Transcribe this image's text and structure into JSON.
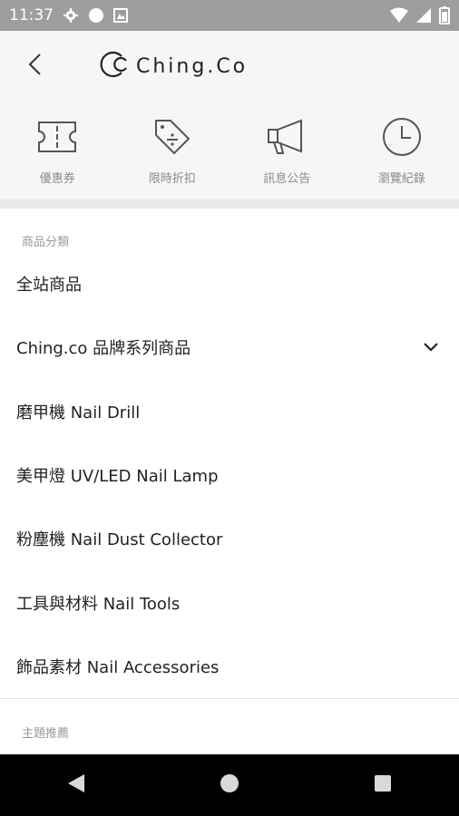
{
  "status_bar": {
    "time": "11:37"
  },
  "app_bar": {
    "brand": "Ching.Co"
  },
  "quick_actions": [
    {
      "label": "優惠券",
      "icon": "ticket-icon"
    },
    {
      "label": "限時折扣",
      "icon": "discount-tag-icon"
    },
    {
      "label": "訊息公告",
      "icon": "megaphone-icon"
    },
    {
      "label": "瀏覽紀錄",
      "icon": "clock-icon"
    }
  ],
  "categories": {
    "title": "商品分類",
    "items": [
      {
        "label": "全站商品"
      },
      {
        "label": "Ching.co 品牌系列商品"
      },
      {
        "label": "磨甲機 Nail Drill"
      },
      {
        "label": "美甲燈 UV/LED Nail Lamp"
      },
      {
        "label": "粉塵機 Nail Dust Collector"
      },
      {
        "label": "工具與材料 Nail Tools"
      },
      {
        "label": "飾品素材 Nail Accessories"
      }
    ]
  },
  "themes": {
    "title": "主題推薦"
  }
}
